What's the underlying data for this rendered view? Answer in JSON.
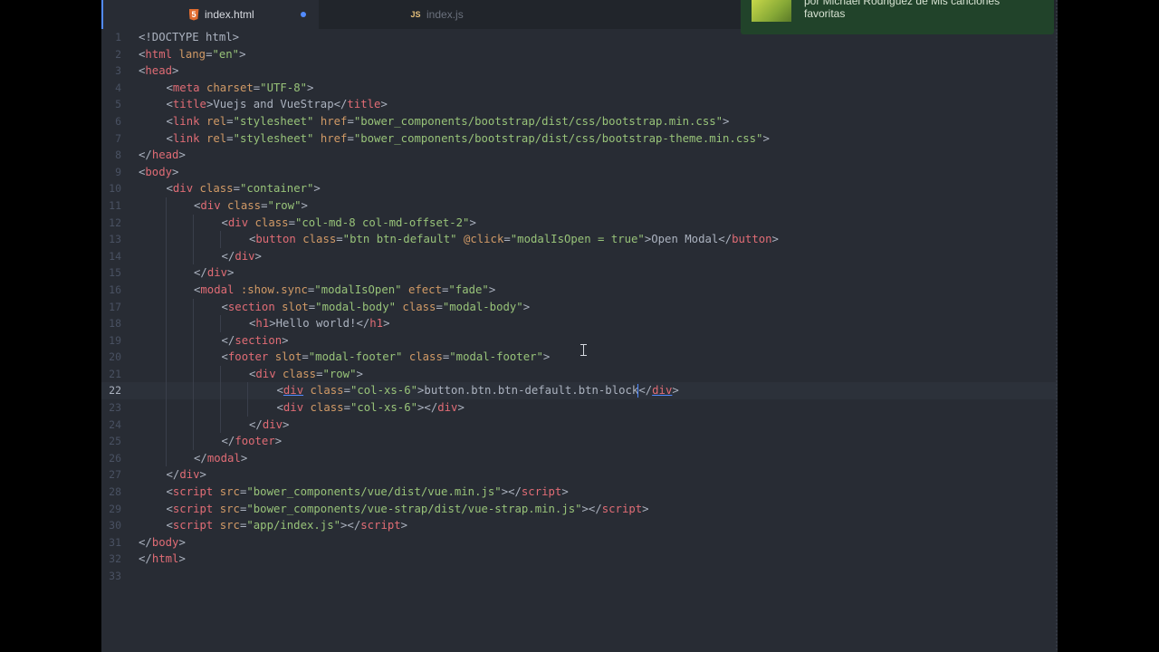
{
  "tabs": [
    {
      "label": "index.html",
      "icon": "html5-icon",
      "active": true,
      "modified": true
    },
    {
      "label": "index.js",
      "icon": "js-icon",
      "active": false
    }
  ],
  "notification": {
    "text": "por Michael Rodriguez de Mis canciones favoritas"
  },
  "editor": {
    "current_line": 22,
    "lines": [
      {
        "n": "1",
        "indent": 0,
        "html": "<span class='p'>&lt;!DOCTYPE html&gt;</span>"
      },
      {
        "n": "2",
        "indent": 0,
        "html": "<span class='p'>&lt;</span><span class='t'>html</span> <span class='a'>lang</span><span class='p'>=</span><span class='s'>\"en\"</span><span class='p'>&gt;</span>"
      },
      {
        "n": "3",
        "indent": 0,
        "html": "<span class='p'>&lt;</span><span class='t'>head</span><span class='p'>&gt;</span>"
      },
      {
        "n": "4",
        "indent": 1,
        "html": "<span class='p'>&lt;</span><span class='t'>meta</span> <span class='a'>charset</span><span class='p'>=</span><span class='s'>\"UTF-8\"</span><span class='p'>&gt;</span>"
      },
      {
        "n": "5",
        "indent": 1,
        "html": "<span class='p'>&lt;</span><span class='t'>title</span><span class='p'>&gt;</span><span class='tx'>Vuejs and VueStrap</span><span class='p'>&lt;/</span><span class='t'>title</span><span class='p'>&gt;</span>"
      },
      {
        "n": "6",
        "indent": 1,
        "html": "<span class='p'>&lt;</span><span class='t'>link</span> <span class='a'>rel</span><span class='p'>=</span><span class='s'>\"stylesheet\"</span> <span class='a'>href</span><span class='p'>=</span><span class='s'>\"bower_components/bootstrap/dist/css/bootstrap.min.css\"</span><span class='p'>&gt;</span>"
      },
      {
        "n": "7",
        "indent": 1,
        "html": "<span class='p'>&lt;</span><span class='t'>link</span> <span class='a'>rel</span><span class='p'>=</span><span class='s'>\"stylesheet\"</span> <span class='a'>href</span><span class='p'>=</span><span class='s'>\"bower_components/bootstrap/dist/css/bootstrap-theme.min.css\"</span><span class='p'>&gt;</span>"
      },
      {
        "n": "8",
        "indent": 0,
        "html": "<span class='p'>&lt;/</span><span class='t'>head</span><span class='p'>&gt;</span>"
      },
      {
        "n": "9",
        "indent": 0,
        "html": "<span class='p'>&lt;</span><span class='t'>body</span><span class='p'>&gt;</span>"
      },
      {
        "n": "10",
        "indent": 1,
        "html": "<span class='p'>&lt;</span><span class='t'>div</span> <span class='a'>class</span><span class='p'>=</span><span class='s'>\"container\"</span><span class='p'>&gt;</span>"
      },
      {
        "n": "11",
        "indent": 2,
        "html": "<span class='p'>&lt;</span><span class='t'>div</span> <span class='a'>class</span><span class='p'>=</span><span class='s'>\"row\"</span><span class='p'>&gt;</span>"
      },
      {
        "n": "12",
        "indent": 3,
        "html": "<span class='p'>&lt;</span><span class='t'>div</span> <span class='a'>class</span><span class='p'>=</span><span class='s'>\"col-md-8 col-md-offset-2\"</span><span class='p'>&gt;</span>"
      },
      {
        "n": "13",
        "indent": 4,
        "html": "<span class='p'>&lt;</span><span class='t'>button</span> <span class='a'>class</span><span class='p'>=</span><span class='s'>\"btn btn-default\"</span> <span class='a'>@click</span><span class='p'>=</span><span class='s'>\"modalIsOpen = true\"</span><span class='p'>&gt;</span><span class='tx'>Open Modal</span><span class='p'>&lt;/</span><span class='t'>button</span><span class='p'>&gt;</span>"
      },
      {
        "n": "14",
        "indent": 3,
        "html": "<span class='p'>&lt;/</span><span class='t'>div</span><span class='p'>&gt;</span>"
      },
      {
        "n": "15",
        "indent": 2,
        "html": "<span class='p'>&lt;/</span><span class='t'>div</span><span class='p'>&gt;</span>"
      },
      {
        "n": "16",
        "indent": 2,
        "html": "<span class='p'>&lt;</span><span class='t'>modal</span> <span class='a'>:show.sync</span><span class='p'>=</span><span class='s'>\"modalIsOpen\"</span> <span class='a'>efect</span><span class='p'>=</span><span class='s'>\"fade\"</span><span class='p'>&gt;</span>"
      },
      {
        "n": "17",
        "indent": 3,
        "html": "<span class='p'>&lt;</span><span class='t'>section</span> <span class='a'>slot</span><span class='p'>=</span><span class='s'>\"modal-body\"</span> <span class='a'>class</span><span class='p'>=</span><span class='s'>\"modal-body\"</span><span class='p'>&gt;</span>"
      },
      {
        "n": "18",
        "indent": 4,
        "html": "<span class='p'>&lt;</span><span class='t'>h1</span><span class='p'>&gt;</span><span class='tx'>Hello world!</span><span class='p'>&lt;/</span><span class='t'>h1</span><span class='p'>&gt;</span>"
      },
      {
        "n": "19",
        "indent": 3,
        "html": "<span class='p'>&lt;/</span><span class='t'>section</span><span class='p'>&gt;</span>"
      },
      {
        "n": "20",
        "indent": 3,
        "html": "<span class='p'>&lt;</span><span class='t'>footer</span> <span class='a'>slot</span><span class='p'>=</span><span class='s'>\"modal-footer\"</span> <span class='a'>class</span><span class='p'>=</span><span class='s'>\"modal-footer\"</span><span class='p'>&gt;</span>"
      },
      {
        "n": "21",
        "indent": 4,
        "html": "<span class='p'>&lt;</span><span class='t'>div</span> <span class='a'>class</span><span class='p'>=</span><span class='s'>\"row\"</span><span class='p'>&gt;</span>"
      },
      {
        "n": "22",
        "indent": 5,
        "html": "<span class='p'>&lt;</span><span class='t uline'>div</span> <span class='a'>class</span><span class='p'>=</span><span class='s'>\"col-xs-6\"</span><span class='p'>&gt;</span><span class='tx'>button.btn.btn-default.btn-block</span><span class='cursor' data-name='text-cursor'></span><span class='p'>&lt;/</span><span class='t uline'>div</span><span class='p'>&gt;</span>"
      },
      {
        "n": "23",
        "indent": 5,
        "html": "<span class='p'>&lt;</span><span class='t'>div</span> <span class='a'>class</span><span class='p'>=</span><span class='s'>\"col-xs-6\"</span><span class='p'>&gt;&lt;/</span><span class='t'>div</span><span class='p'>&gt;</span>"
      },
      {
        "n": "24",
        "indent": 4,
        "html": "<span class='p'>&lt;/</span><span class='t'>div</span><span class='p'>&gt;</span>"
      },
      {
        "n": "25",
        "indent": 3,
        "html": "<span class='p'>&lt;/</span><span class='t'>footer</span><span class='p'>&gt;</span>"
      },
      {
        "n": "26",
        "indent": 2,
        "html": "<span class='p'>&lt;/</span><span class='t'>modal</span><span class='p'>&gt;</span>"
      },
      {
        "n": "27",
        "indent": 1,
        "html": "<span class='p'>&lt;/</span><span class='t'>div</span><span class='p'>&gt;</span>"
      },
      {
        "n": "28",
        "indent": 1,
        "html": "<span class='p'>&lt;</span><span class='t'>script</span> <span class='a'>src</span><span class='p'>=</span><span class='s'>\"bower_components/vue/dist/vue.min.js\"</span><span class='p'>&gt;&lt;/</span><span class='t'>script</span><span class='p'>&gt;</span>"
      },
      {
        "n": "29",
        "indent": 1,
        "html": "<span class='p'>&lt;</span><span class='t'>script</span> <span class='a'>src</span><span class='p'>=</span><span class='s'>\"bower_components/vue-strap/dist/vue-strap.min.js\"</span><span class='p'>&gt;&lt;/</span><span class='t'>script</span><span class='p'>&gt;</span>"
      },
      {
        "n": "30",
        "indent": 1,
        "html": "<span class='p'>&lt;</span><span class='t'>script</span> <span class='a'>src</span><span class='p'>=</span><span class='s'>\"app/index.js\"</span><span class='p'>&gt;&lt;/</span><span class='t'>script</span><span class='p'>&gt;</span>"
      },
      {
        "n": "31",
        "indent": 0,
        "html": "<span class='p'>&lt;/</span><span class='t'>body</span><span class='p'>&gt;</span>"
      },
      {
        "n": "32",
        "indent": 0,
        "html": "<span class='p'>&lt;/</span><span class='t'>html</span><span class='p'>&gt;</span>"
      },
      {
        "n": "33",
        "indent": 0,
        "html": ""
      }
    ]
  }
}
